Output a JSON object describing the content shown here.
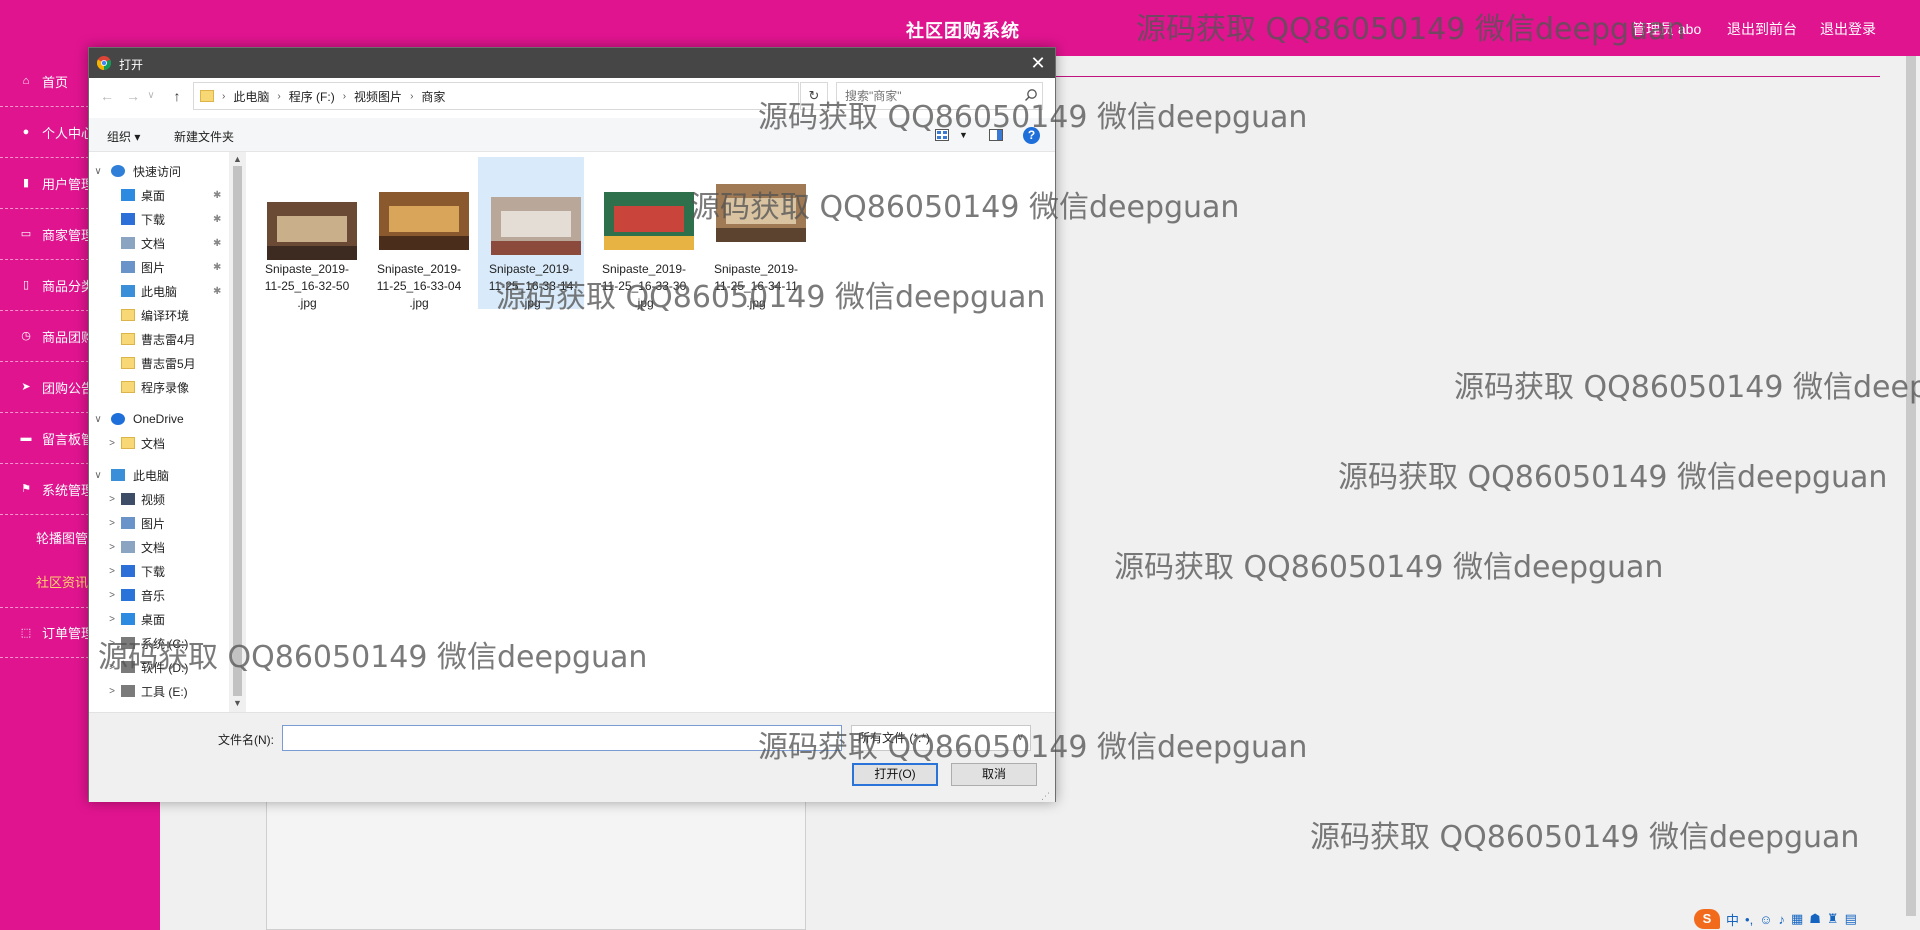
{
  "app": {
    "title": "社区团购系统",
    "user": "管理员 abo",
    "nav_front": "退出到前台",
    "nav_logout": "退出登录"
  },
  "sidebar": {
    "items": [
      {
        "label": "首页",
        "icon": "home-icon"
      },
      {
        "label": "个人中心",
        "icon": "user-icon"
      },
      {
        "label": "用户管理",
        "icon": "chart-icon"
      },
      {
        "label": "商家管理",
        "icon": "store-icon"
      },
      {
        "label": "商品分类管理",
        "icon": "category-icon"
      },
      {
        "label": "商品团购管理",
        "icon": "clock-icon"
      },
      {
        "label": "团购公告",
        "icon": "send-icon"
      },
      {
        "label": "留言板管理",
        "icon": "message-icon"
      },
      {
        "label": "系统管理",
        "icon": "flag-icon"
      }
    ],
    "sub_items": [
      {
        "label": "轮播图管理"
      },
      {
        "label": "社区资讯"
      }
    ],
    "last_item": {
      "label": "订单管理",
      "icon": "order-icon"
    }
  },
  "dialog": {
    "title": "打开",
    "breadcrumb": [
      "此电脑",
      "程序 (F:)",
      "视频图片",
      "商家"
    ],
    "search_placeholder": "搜索\"商家\"",
    "organize": "组织 ▾",
    "new_folder": "新建文件夹",
    "nav_tree": [
      {
        "label": "快速访问",
        "level": 0,
        "icon": "star-icon",
        "expander": "∨"
      },
      {
        "label": "桌面",
        "level": 1,
        "icon": "desktop-icon",
        "pinned": true
      },
      {
        "label": "下载",
        "level": 1,
        "icon": "download-icon",
        "pinned": true
      },
      {
        "label": "文档",
        "level": 1,
        "icon": "document-icon",
        "pinned": true
      },
      {
        "label": "图片",
        "level": 1,
        "icon": "picture-icon",
        "pinned": true
      },
      {
        "label": "此电脑",
        "level": 1,
        "icon": "computer-icon",
        "pinned": true
      },
      {
        "label": "编译环境",
        "level": 1,
        "icon": "folder-icon"
      },
      {
        "label": "曹志雷4月",
        "level": 1,
        "icon": "folder-icon"
      },
      {
        "label": "曹志雷5月",
        "level": 1,
        "icon": "folder-icon"
      },
      {
        "label": "程序录像",
        "level": 1,
        "icon": "folder-icon"
      },
      {
        "label": "OneDrive",
        "level": 0,
        "icon": "cloud-icon",
        "expander": "∨",
        "gap": true
      },
      {
        "label": "文档",
        "level": 1,
        "icon": "folder-icon",
        "expander": ">"
      },
      {
        "label": "此电脑",
        "level": 0,
        "icon": "computer-icon",
        "expander": "∨",
        "gap": true
      },
      {
        "label": "视频",
        "level": 1,
        "icon": "video-icon",
        "expander": ">"
      },
      {
        "label": "图片",
        "level": 1,
        "icon": "picture-icon",
        "expander": ">"
      },
      {
        "label": "文档",
        "level": 1,
        "icon": "document-icon",
        "expander": ">"
      },
      {
        "label": "下载",
        "level": 1,
        "icon": "download-icon",
        "expander": ">"
      },
      {
        "label": "音乐",
        "level": 1,
        "icon": "music-icon",
        "expander": ">"
      },
      {
        "label": "桌面",
        "level": 1,
        "icon": "desktop-icon",
        "expander": ">"
      },
      {
        "label": "系统 (C:)",
        "level": 1,
        "icon": "drive-icon",
        "expander": ">"
      },
      {
        "label": "软件 (D:)",
        "level": 1,
        "icon": "drive-icon",
        "expander": ">"
      },
      {
        "label": "工具 (E:)",
        "level": 1,
        "icon": "drive-icon",
        "expander": ">"
      }
    ],
    "files": [
      {
        "name": "Snipaste_2019-11-25_16-32-50.jpg",
        "lines": [
          "Snipaste_2019-",
          "11-25_16-32-50",
          ".jpg"
        ],
        "colors": [
          "#6b4a35",
          "#c9b08a",
          "#3d2a20"
        ],
        "selected": false
      },
      {
        "name": "Snipaste_2019-11-25_16-33-04.jpg",
        "lines": [
          "Snipaste_2019-",
          "11-25_16-33-04",
          ".jpg"
        ],
        "colors": [
          "#8a5a2e",
          "#d8a55a",
          "#4a2d1a"
        ],
        "selected": false
      },
      {
        "name": "Snipaste_2019-11-25_16-33-14.jpg",
        "lines": [
          "Snipaste_2019-",
          "11-25_16-33-14",
          ".jpg"
        ],
        "colors": [
          "#b9a79a",
          "#e4ddd6",
          "#8c4a3c"
        ],
        "selected": true
      },
      {
        "name": "Snipaste_2019-11-25_16-33-30.jpg",
        "lines": [
          "Snipaste_2019-",
          "11-25_16-33-30",
          ".jpg"
        ],
        "colors": [
          "#2e6f4c",
          "#c9443a",
          "#e7b443"
        ],
        "selected": false
      },
      {
        "name": "Snipaste_2019-11-25_16-34-11.jpg",
        "lines": [
          "Snipaste_2019-",
          "11-25_16-34-11",
          ".jpg"
        ],
        "colors": [
          "#a07a55",
          "#d9c3a1",
          "#5c4330"
        ],
        "selected": false
      }
    ],
    "filename_label": "文件名(N):",
    "filename_value": "",
    "filetype": "所有文件 (*.*)",
    "open_button": "打开(O)",
    "cancel_button": "取消"
  },
  "watermark_text": "源码获取 QQ86050149 微信deepguan",
  "tray": {
    "ime": "中",
    "punct": "•,"
  }
}
